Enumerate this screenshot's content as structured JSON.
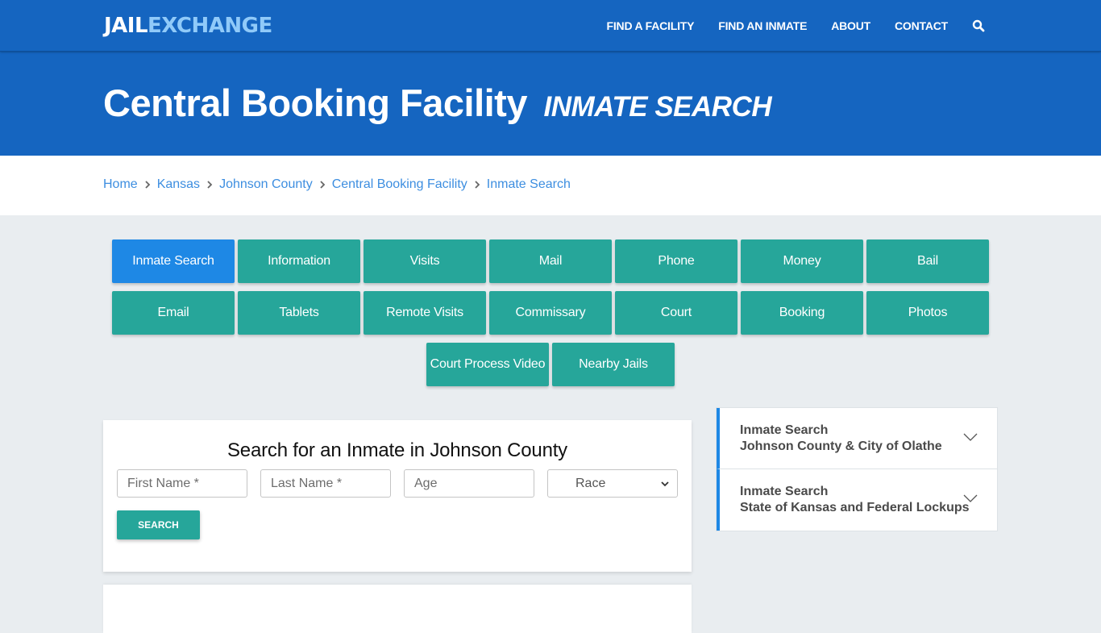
{
  "header": {
    "logo_part1": "JAIL",
    "logo_part2": "EXCHANGE",
    "nav": [
      "FIND A FACILITY",
      "FIND AN INMATE",
      "ABOUT",
      "CONTACT"
    ],
    "search_icon": "search-icon"
  },
  "hero": {
    "title": "Central Booking Facility",
    "subtitle": "INMATE SEARCH"
  },
  "breadcrumb": [
    "Home",
    "Kansas",
    "Johnson County",
    "Central Booking Facility",
    "Inmate Search"
  ],
  "tabs": {
    "row1": [
      "Inmate Search",
      "Information",
      "Visits",
      "Mail",
      "Phone",
      "Money",
      "Bail"
    ],
    "row2": [
      "Email",
      "Tablets",
      "Remote Visits",
      "Commissary",
      "Court",
      "Booking",
      "Photos"
    ],
    "row3": [
      "Court Process Video",
      "Nearby Jails"
    ],
    "active": "Inmate Search"
  },
  "search_form": {
    "title": "Search for an Inmate in Johnson County",
    "first_name_placeholder": "First Name *",
    "last_name_placeholder": "Last Name *",
    "age_placeholder": "Age",
    "race_selected": "Race",
    "button_label": "SEARCH"
  },
  "accordion": [
    {
      "line1": "Inmate Search",
      "line2": "Johnson County & City of Olathe"
    },
    {
      "line1": "Inmate Search",
      "line2": "State of Kansas and Federal Lockups"
    }
  ],
  "colors": {
    "brand_blue": "#1565c0",
    "logo_accent": "#90caf9",
    "teal": "#26a69a",
    "active_tab": "#1e88e5",
    "link": "#3d8ee0"
  }
}
